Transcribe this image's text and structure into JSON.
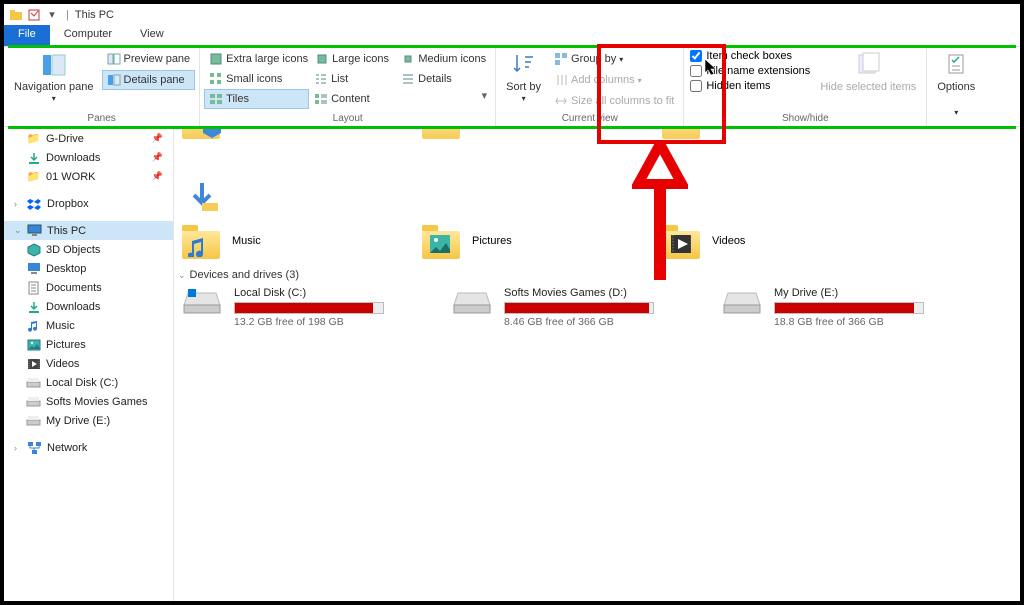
{
  "window": {
    "title": "This PC"
  },
  "tabs": {
    "file": "File",
    "computer": "Computer",
    "view": "View"
  },
  "ribbon": {
    "panes": {
      "nav_pane": "Navigation pane",
      "preview": "Preview pane",
      "details": "Details pane",
      "label": "Panes"
    },
    "layout": {
      "extra_large": "Extra large icons",
      "large": "Large icons",
      "medium": "Medium icons",
      "small": "Small icons",
      "list": "List",
      "details": "Details",
      "tiles": "Tiles",
      "content": "Content",
      "label": "Layout"
    },
    "current_view": {
      "sort_by": "Sort by",
      "group_by": "Group by",
      "add_columns": "Add columns",
      "size_all": "Size all columns to fit",
      "label": "Current view"
    },
    "show_hide": {
      "item_checkboxes": "Item check boxes",
      "file_ext": "File name extensions",
      "hidden": "Hidden items",
      "hide_selected": "Hide selected items",
      "label": "Show/hide"
    },
    "options": "Options"
  },
  "nav": {
    "gdrive": "G-Drive",
    "downloads": "Downloads",
    "work": "01 WORK",
    "dropbox": "Dropbox",
    "this_pc": "This PC",
    "3d": "3D Objects",
    "desktop": "Desktop",
    "documents": "Documents",
    "downloads2": "Downloads",
    "music": "Music",
    "pictures": "Pictures",
    "videos": "Videos",
    "local_c": "Local Disk (C:)",
    "softs_d": "Softs Movies Games",
    "my_drive_e": "My Drive (E:)",
    "network": "Network"
  },
  "content": {
    "folders": {
      "music": "Music",
      "pictures": "Pictures",
      "videos": "Videos"
    },
    "section_drives": "Devices and drives (3)",
    "drives": [
      {
        "name": "Local Disk (C:)",
        "sub": "13.2 GB free of 198 GB",
        "pct": 93
      },
      {
        "name": "Softs Movies Games (D:)",
        "sub": "8.46 GB free of 366 GB",
        "pct": 97
      },
      {
        "name": "My Drive (E:)",
        "sub": "18.8 GB free of 366 GB",
        "pct": 94
      }
    ]
  }
}
